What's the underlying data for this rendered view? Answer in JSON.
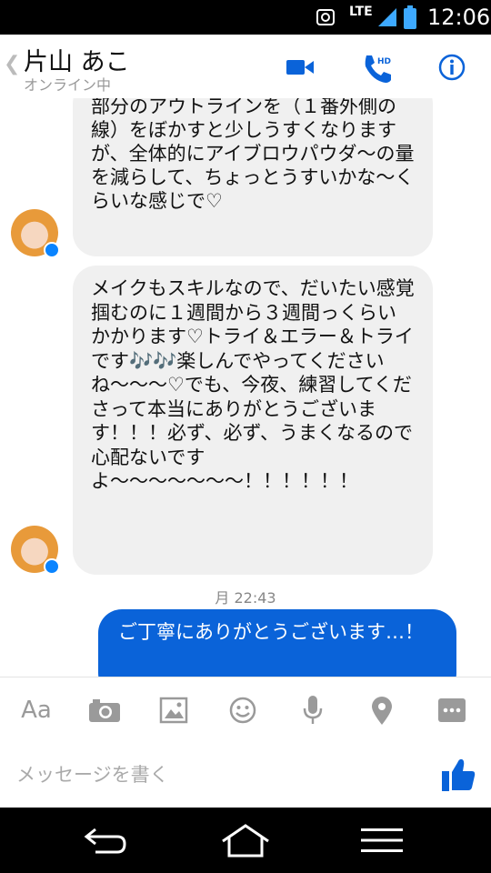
{
  "status_bar": {
    "network": "LTE",
    "time": "12:06"
  },
  "header": {
    "back_icon": "chevron-left-icon",
    "contact_name": "片山 あこ",
    "contact_status": "オンライン中"
  },
  "messages": [
    {
      "text": "部分のアウトラインを（１番外側の線）をぼかすと少しうすくなりますが、全体的にアイブロウパウダ〜の量を減らして、ちょっとうすいかな〜くらいな感じで♡"
    },
    {
      "text": "メイクもスキルなので、だいたい感覚掴むのに１週間から３週間っくらいかかります♡トライ＆エラー＆トライです🎶🎶楽しんでやってくださいね〜〜〜♡でも、今夜、練習してくださって本当にありがとうございます！！！必ず、必ず、うまくなるので心配ないですよ〜〜〜〜〜〜〜！！！！！！"
    },
    {
      "timestamp": "月 22:43"
    },
    {
      "text": "ご丁寧にありがとうございます…！"
    }
  ],
  "toolbar": {
    "text_label": "Aa"
  },
  "compose": {
    "placeholder": "メッセージを書く"
  },
  "colors": {
    "accent": "#0a63d9",
    "incoming_bubble": "#f0f0f0"
  }
}
